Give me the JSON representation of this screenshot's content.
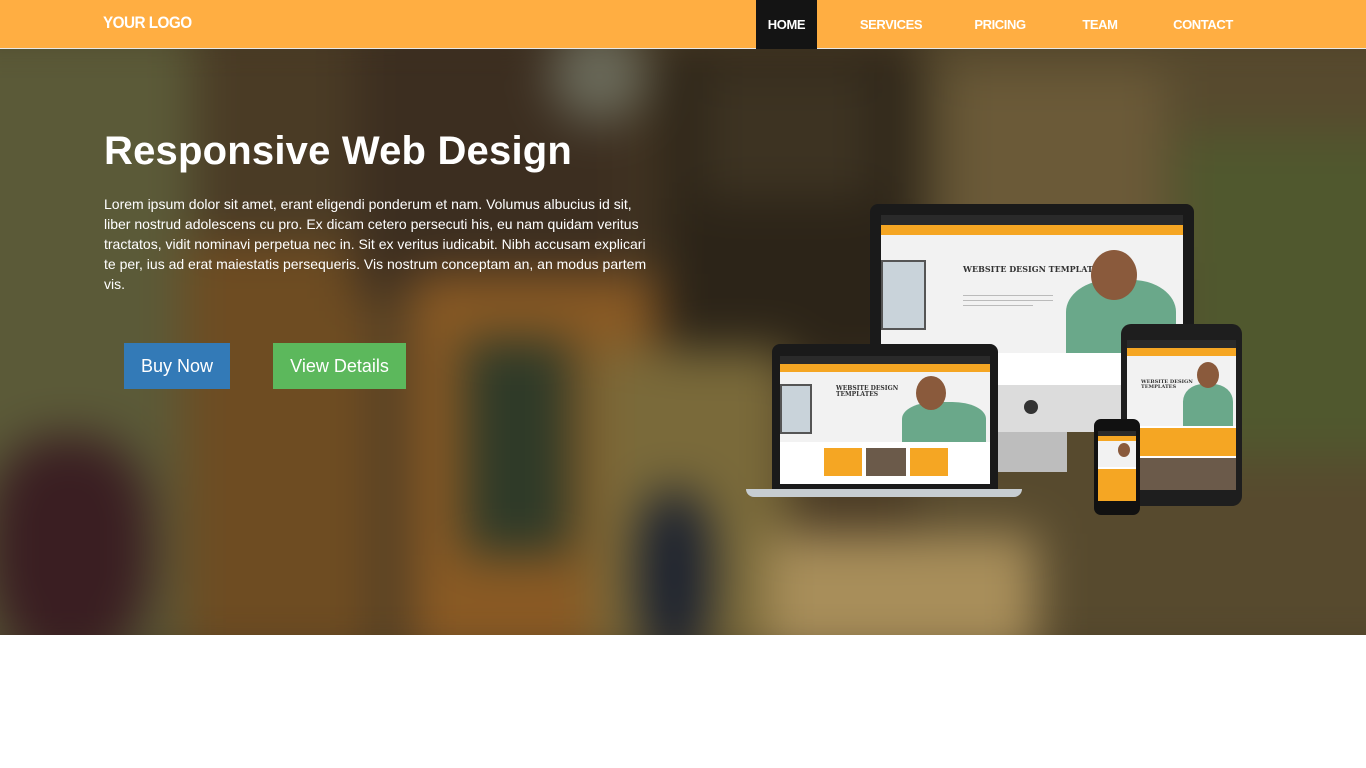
{
  "navbar": {
    "logo": "YOUR LOGO",
    "items": [
      {
        "label": "HOME",
        "active": true
      },
      {
        "label": "SERVICES",
        "active": false
      },
      {
        "label": "PRICING",
        "active": false
      },
      {
        "label": "TEAM",
        "active": false
      },
      {
        "label": "CONTACT",
        "active": false
      }
    ]
  },
  "hero": {
    "title": "Responsive Web Design",
    "text": "Lorem ipsum dolor sit amet, erant eligendi ponderum et nam. Volumus albucius id sit, liber nostrud adolescens cu pro. Ex dicam cetero persecuti his, eu nam quidam veritus tractatos, vidit nominavi perpetua nec in. Sit ex veritus iudicabit. Nibh accusam explicari te per, ius ad erat maiestatis persequeris. Vis nostrum conceptam an, an modus partem vis.",
    "buttons": {
      "buy": "Buy Now",
      "details": "View Details"
    },
    "device_screen": {
      "heading": "WEBSITE DESIGN TEMPLATES"
    }
  },
  "colors": {
    "navbar": "#ffae42",
    "nav_active": "#141414",
    "buy_button": "#337ab7",
    "details_button": "#5cb85c",
    "accent": "#f5a623"
  },
  "icons": {
    "brand_mark": "apple-logo-icon"
  }
}
